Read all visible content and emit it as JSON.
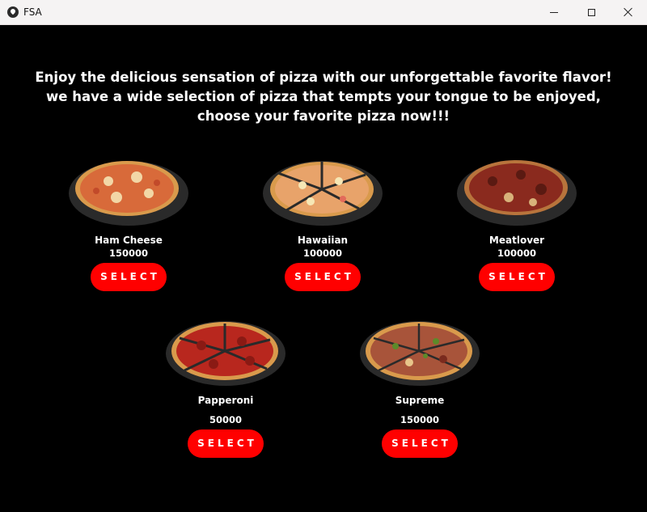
{
  "window": {
    "title": "FSA"
  },
  "headline": {
    "line1": "Enjoy the delicious sensation of pizza with our unforgettable favorite flavor!",
    "line2": "we have a wide selection of pizza that tempts your tongue to be enjoyed,",
    "line3": "choose your favorite pizza now!!!"
  },
  "pizzas": [
    {
      "name": "Ham Cheese",
      "price": "150000",
      "button": "SELECT",
      "topping_color": "#d86a3a"
    },
    {
      "name": "Hawaiian",
      "price": "100000",
      "button": "SELECT",
      "topping_color": "#e8a36a"
    },
    {
      "name": "Meatlover",
      "price": "100000",
      "button": "SELECT",
      "topping_color": "#8a2a1e"
    },
    {
      "name": "Papperoni",
      "price": "50000",
      "button": "SELECT",
      "topping_color": "#b8271e"
    },
    {
      "name": "Supreme",
      "price": "150000",
      "button": "SELECT",
      "topping_color": "#a8543a"
    }
  ],
  "colors": {
    "background": "#000000",
    "accent": "#ff0000",
    "text": "#ffffff"
  }
}
